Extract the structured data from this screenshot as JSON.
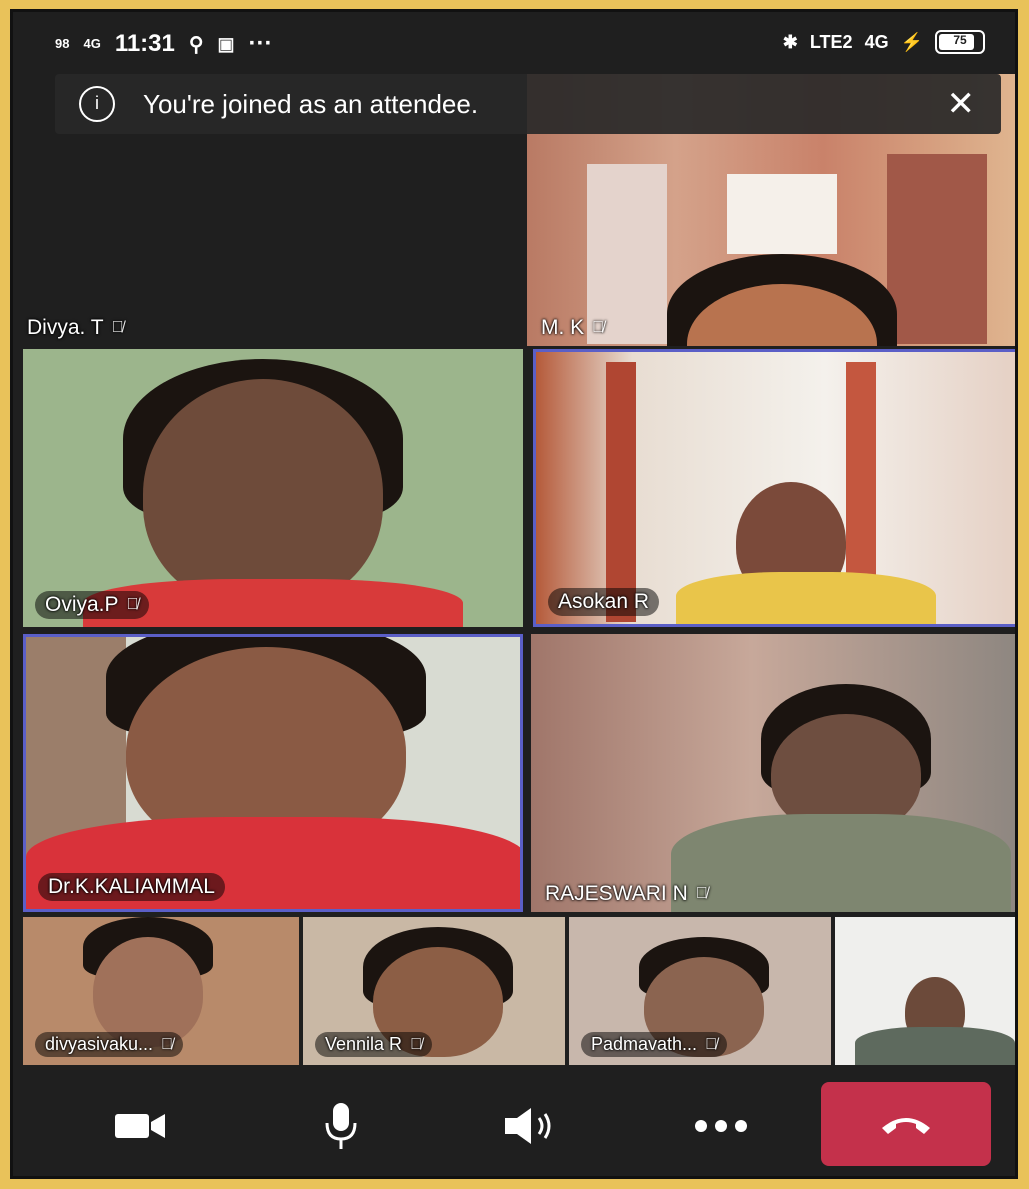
{
  "status_bar": {
    "time": "11:31",
    "signal_left": "98",
    "signal_mid": "4G",
    "right_net": "LTE2",
    "right_net2": "4G",
    "battery": "75"
  },
  "banner": {
    "text": "You're joined as an attendee."
  },
  "participants": {
    "divya_t": "Divya. T",
    "m_k": "M. K",
    "oviya_p": "Oviya.P",
    "asokan_r": "Asokan R",
    "kaliammal": "Dr.K.KALIAMMAL",
    "rajeswari": "RAJESWARI N",
    "divyasivaku": "divyasivaku...",
    "vennila": "Vennila R",
    "padmavath": "Padmavath..."
  },
  "controls": {
    "camera": "camera-icon",
    "mic": "mic-icon",
    "speaker": "speaker-icon",
    "more": "more-icon",
    "hangup": "hangup-icon",
    "hangup_color": "#c4314b"
  },
  "colors": {
    "active_border": "#5b5fc7"
  }
}
